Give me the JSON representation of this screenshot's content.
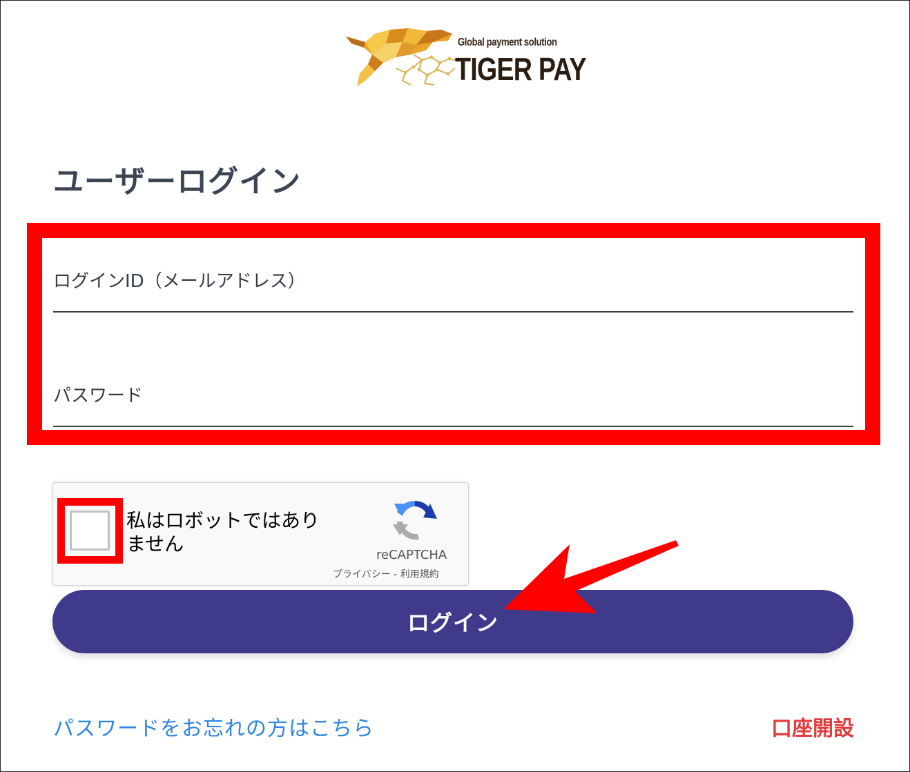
{
  "brand": {
    "tagline": "Global payment solution",
    "name": "TIGER PAY"
  },
  "page_title": "ユーザーログイン",
  "form": {
    "login_id_label": "ログインID（メールアドレス）",
    "login_id_value": "",
    "password_label": "パスワード",
    "password_value": ""
  },
  "recaptcha": {
    "label": "私はロボットではありません",
    "brand": "reCAPTCHA",
    "privacy_link": "プライバシー",
    "separator": " - ",
    "terms_link": "利用規約",
    "checked": false
  },
  "login_button_label": "ログイン",
  "links": {
    "forgot_password": "パスワードをお忘れの方はこちら",
    "open_account": "口座開設"
  },
  "colors": {
    "highlight": "#ff0000",
    "button": "#3f3a8c",
    "link": "#2f86e0",
    "open_account": "#e23b3b"
  }
}
